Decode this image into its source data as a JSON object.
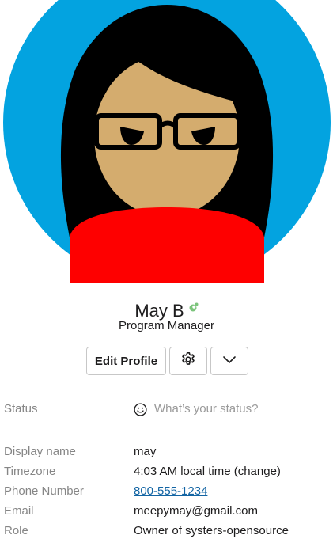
{
  "profile": {
    "name": "May B",
    "title": "Program Manager"
  },
  "actions": {
    "edit_label": "Edit Profile",
    "settings_icon": "gear-icon",
    "more_icon": "chevron-down-icon"
  },
  "status": {
    "label": "Status",
    "placeholder": "What’s your status?",
    "icon": "smile-icon"
  },
  "fields": {
    "display_name": {
      "label": "Display name",
      "value": "may"
    },
    "timezone": {
      "label": "Timezone",
      "value": "4:03 AM local time (change)"
    },
    "phone": {
      "label": "Phone Number",
      "value": "800-555-1234"
    },
    "email": {
      "label": "Email",
      "value": "meepymay@gmail.com"
    },
    "role": {
      "label": "Role",
      "value": "Owner of systers-opensource"
    }
  },
  "colors": {
    "avatar_bg": "#03a3e0",
    "hair": "#000000",
    "skin": "#d4ac6e",
    "shirt": "#fe0000",
    "presence": "#7cc47c",
    "link": "#1264a3"
  }
}
